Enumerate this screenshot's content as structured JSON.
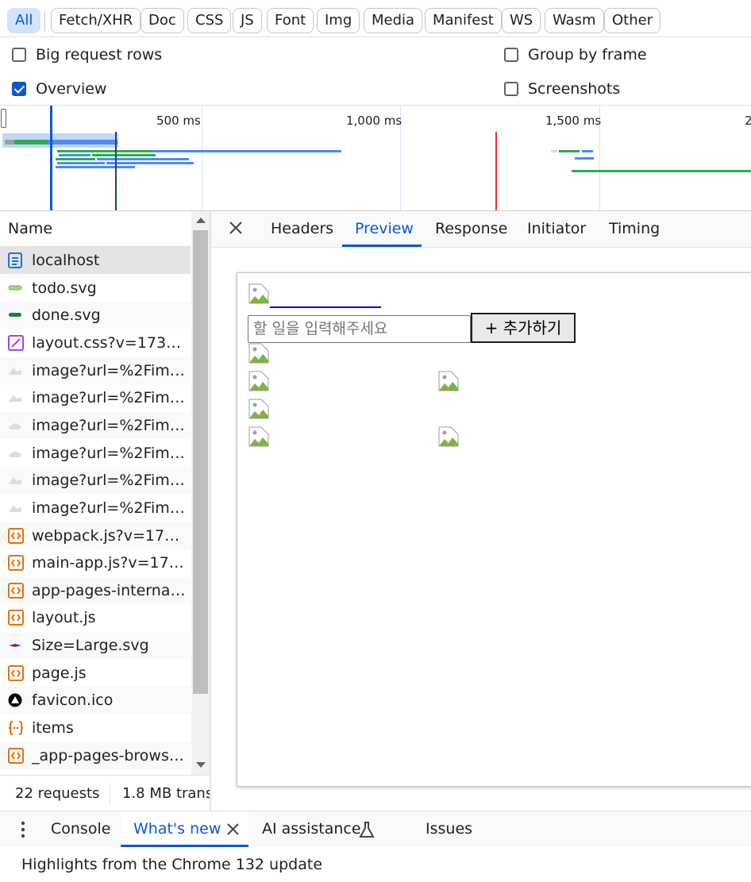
{
  "filters": [
    "All",
    "Fetch/XHR",
    "Doc",
    "CSS",
    "JS",
    "Font",
    "Img",
    "Media",
    "Manifest",
    "WS",
    "Wasm",
    "Other"
  ],
  "options": {
    "big_request_rows": "Big request rows",
    "group_by_frame": "Group by frame",
    "overview": "Overview",
    "screenshots": "Screenshots",
    "big_request_rows_checked": false,
    "group_by_frame_checked": false,
    "overview_checked": true,
    "screenshots_checked": false
  },
  "overview_ticks": [
    "500 ms",
    "1,000 ms",
    "1,500 ms",
    "2"
  ],
  "name_header": "Name",
  "requests": [
    {
      "name": "localhost",
      "icon": "document-icon"
    },
    {
      "name": "todo.svg",
      "icon": "svg-image-icon"
    },
    {
      "name": "done.svg",
      "icon": "svg-image-icon"
    },
    {
      "name": "layout.css?v=17383...",
      "icon": "stylesheet-icon"
    },
    {
      "name": "image?url=%2Fima...",
      "icon": "image-icon"
    },
    {
      "name": "image?url=%2Fima...",
      "icon": "image-icon"
    },
    {
      "name": "image?url=%2Fima...",
      "icon": "image-icon"
    },
    {
      "name": "image?url=%2Fima...",
      "icon": "image-icon"
    },
    {
      "name": "image?url=%2Fima...",
      "icon": "image-icon"
    },
    {
      "name": "image?url=%2Fima...",
      "icon": "image-icon"
    },
    {
      "name": "webpack.js?v=1738...",
      "icon": "script-icon"
    },
    {
      "name": "main-app.js?v=173...",
      "icon": "script-icon"
    },
    {
      "name": "app-pages-internals...",
      "icon": "script-icon"
    },
    {
      "name": "layout.js",
      "icon": "script-icon"
    },
    {
      "name": "Size=Large.svg",
      "icon": "svg-image-icon"
    },
    {
      "name": "page.js",
      "icon": "script-icon"
    },
    {
      "name": "favicon.ico",
      "icon": "favicon-icon"
    },
    {
      "name": "items",
      "icon": "json-icon"
    },
    {
      "name": "_app-pages-browse...",
      "icon": "script-icon"
    }
  ],
  "status": {
    "requests": "22 requests",
    "transferred": "1.8 MB trans"
  },
  "detail_tabs": [
    "Headers",
    "Preview",
    "Response",
    "Initiator",
    "Timing"
  ],
  "active_detail_tab": "Preview",
  "preview": {
    "input_placeholder": "할 일을 입력해주세요",
    "add_button": "+ 추가하기"
  },
  "drawer_tabs": {
    "console": "Console",
    "whats_new": "What's new",
    "ai_assistance": "AI assistance",
    "issues": "Issues"
  },
  "drawer_content": "Highlights from the Chrome 132 update",
  "colors": {
    "accent": "#0b57d0",
    "selected_chip": "#d3e3fd",
    "waterfall_blue": "#4c8bf5",
    "waterfall_green": "#34a853",
    "marker_red": "#e53935"
  }
}
